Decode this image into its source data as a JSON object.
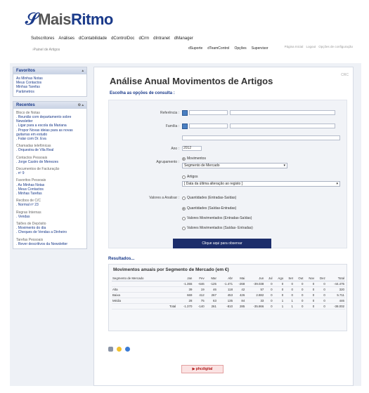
{
  "header": {
    "logo_mais": "Mais",
    "logo_ritmo": "Ritmo",
    "nav": [
      "Subscritores",
      "Análises",
      "dContabilidade",
      "dControlDoc",
      "dCrm",
      "dIntranet",
      "dManager",
      "dSuporte",
      "dTeamControl",
      "Opções",
      "Supervisor"
    ],
    "crumb": "Painel de Artigos",
    "toplinks": [
      "Página Inicial",
      "Logout",
      "Opções de configuração"
    ]
  },
  "sidebar": {
    "favoritos": {
      "title": "Favoritos",
      "items": [
        "As Minhas Notas",
        "Meus Contactos",
        "Minhas Tarefas",
        "Parâmetros"
      ]
    },
    "recentes": {
      "title": "Recentes",
      "groups": [
        {
          "name": "Bloco de Notas",
          "items": [
            ". Reunião com departamento sobre Newsletter",
            ". Ligar para a escola da Mariana",
            ". Propor Novas ideias para as novas guitarras em estudo",
            ". Falar com Dr. Eva"
          ]
        },
        {
          "name": "Chamadas telefónicas",
          "items": [
            ". Orquestra de Vila Real"
          ]
        },
        {
          "name": "Contactos Pessoais",
          "items": [
            ". Jorge Castro de Menezes"
          ]
        },
        {
          "name": "Documentos de Facturação",
          "items": [
            ". nº 9"
          ]
        },
        {
          "name": "Favoritos Pessoais",
          "items": [
            ". As Minhas Notas",
            ". Meus Contactos",
            ". Minhas Tarefas"
          ]
        },
        {
          "name": "Recibos de C/C",
          "items": [
            ". Normal nº 23"
          ]
        },
        {
          "name": "Regras Internas",
          "items": [
            ". Vendas"
          ]
        },
        {
          "name": "Talões de Depósito",
          "items": [
            ". Movimento do dia",
            ". Cheques de Vendas a Dinheiro"
          ]
        },
        {
          "name": "Tarefas Pessoais",
          "items": [
            ". Rever descritivos da Newsletter"
          ]
        }
      ]
    }
  },
  "main": {
    "title": "Análise Anual Movimentos de Artigos",
    "corner": "CRC",
    "subtitle": "Escolha as opções de consulta :",
    "form": {
      "referencia_label": "Referência :",
      "familia_label": "Família :",
      "ano_label": "Ano :",
      "ano_value": "2012",
      "agrupamento_label": "Agrupamento :",
      "agr_opt1": "Movimentos",
      "agr_select1": "Segmento de Mercado",
      "agr_opt2": "Artigos",
      "agr_select2": "[ Data da última alteração ao registo ]",
      "valores_label": "Valores a Analisar :",
      "val_opts": [
        "Quantidades (Entradas-Saídas)",
        "Quantidades (Saídas-Entradas)",
        "Valores Movimentados (Entradas-Saídas)",
        "Valores Movimentados (Saídas- Entradas)"
      ],
      "button": "Clique aqui para observar"
    },
    "results_label": "Resultados...",
    "results_title": "Movimentos anuais por Segmento de Mercado (em €)",
    "table": {
      "headers": [
        "Segmento de Mercado",
        "",
        "Jan",
        "Fev",
        "Mar",
        "Abr",
        "Mai",
        "Jun",
        "Jul",
        "Ago",
        "Set",
        "Out",
        "Nov",
        "Dez",
        "Total"
      ],
      "rows": [
        [
          "",
          "",
          "-1.355",
          "-646",
          "-125",
          "-1.471",
          "-268",
          "-39.038",
          "0",
          "0",
          "0",
          "0",
          "0",
          "0",
          "-44.475"
        ],
        [
          "Alta",
          "",
          "39",
          "19",
          "46",
          "118",
          "42",
          "57",
          "0",
          "0",
          "0",
          "0",
          "0",
          "0",
          "320"
        ],
        [
          "Baixa",
          "",
          "669",
          "412",
          "267",
          "453",
          "426",
          "2.882",
          "0",
          "0",
          "0",
          "0",
          "0",
          "0",
          "5.711"
        ],
        [
          "Média",
          "",
          "28",
          "75",
          "63",
          "135",
          "84",
          "33",
          "0",
          "1",
          "1",
          "0",
          "0",
          "0",
          "446"
        ],
        [
          "",
          "Total",
          "-1.370",
          "-140",
          "261",
          "-810",
          "285",
          "-35.866",
          "0",
          "1",
          "1",
          "0",
          "0",
          "0",
          "-38.002"
        ]
      ]
    }
  },
  "footer": {
    "brand": "phcdigital"
  }
}
